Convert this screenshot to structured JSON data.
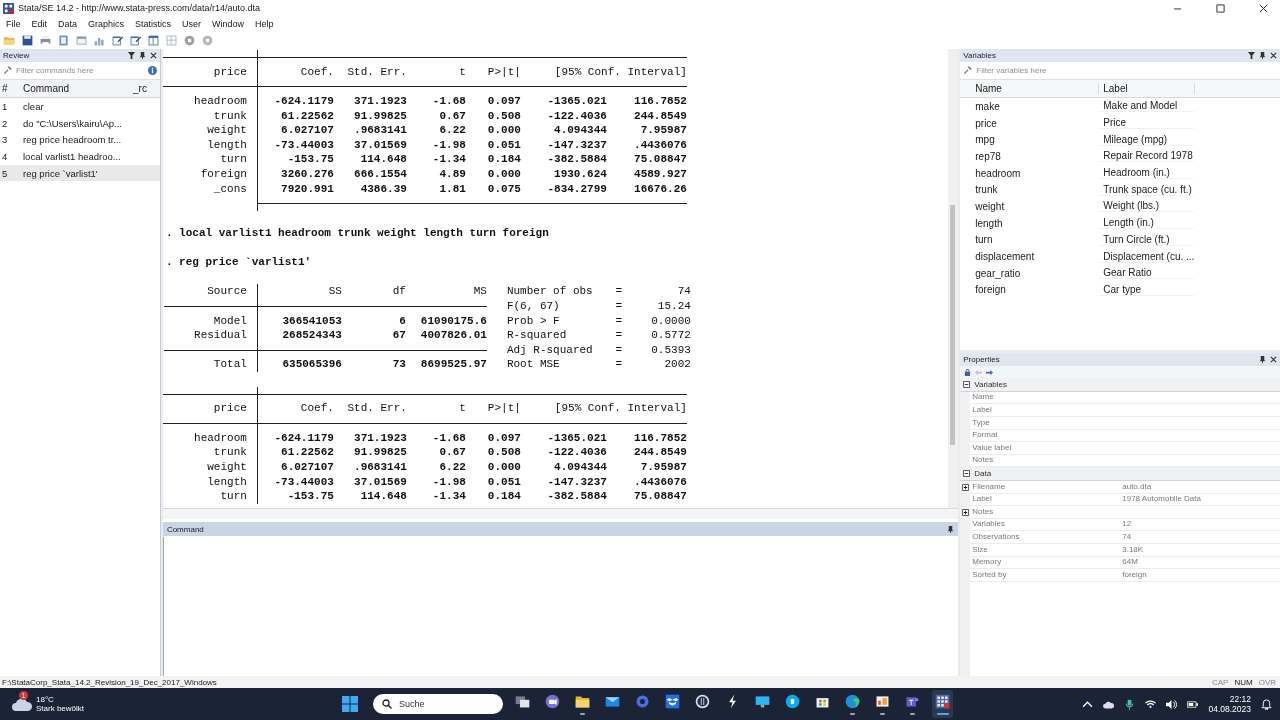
{
  "window": {
    "title": "Stata/SE 14.2 - http://www.stata-press.com/data/r14/auto.dta"
  },
  "menu": [
    "File",
    "Edit",
    "Data",
    "Graphics",
    "Statistics",
    "User",
    "Window",
    "Help"
  ],
  "review": {
    "title": "Review",
    "placeholder": "Filter commands here",
    "columns": [
      "#",
      "Command",
      "_rc"
    ],
    "rows": [
      {
        "n": "1",
        "command": "clear",
        "selected": false
      },
      {
        "n": "2",
        "command": "do \"C:\\Users\\kairu\\Ap...",
        "selected": false
      },
      {
        "n": "3",
        "command": "reg price headroom tr...",
        "selected": false
      },
      {
        "n": "4",
        "command": "local varlist1 headroo...",
        "selected": false
      },
      {
        "n": "5",
        "command": "reg price `varlist1'",
        "selected": true
      }
    ]
  },
  "results": [
    {
      "kind": "coef_table",
      "bottom_rule": true,
      "header": [
        "price",
        "Coef.",
        "Std. Err.",
        "t",
        "P>|t|",
        "[95% Conf. Interval]"
      ],
      "rows": [
        {
          "name": "headroom",
          "values": [
            "-624.1179",
            "371.1923",
            "-1.68",
            "0.097",
            "-1365.021",
            "116.7852"
          ]
        },
        {
          "name": "trunk",
          "values": [
            "61.22562",
            "91.99825",
            "0.67",
            "0.508",
            "-122.4036",
            "244.8549"
          ]
        },
        {
          "name": "weight",
          "values": [
            "6.027107",
            ".9683141",
            "6.22",
            "0.000",
            "4.094344",
            "7.95987"
          ]
        },
        {
          "name": "length",
          "values": [
            "-73.44003",
            "37.01569",
            "-1.98",
            "0.051",
            "-147.3237",
            ".4436076"
          ]
        },
        {
          "name": "turn",
          "values": [
            "-153.75",
            "114.648",
            "-1.34",
            "0.184",
            "-382.5884",
            "75.08847"
          ]
        },
        {
          "name": "foreign",
          "values": [
            "3260.276",
            "666.1554",
            "4.89",
            "0.000",
            "1930.624",
            "4589.927"
          ]
        },
        {
          "name": "_cons",
          "values": [
            "7920.991",
            "4386.39",
            "1.81",
            "0.075",
            "-834.2799",
            "16676.26"
          ]
        }
      ]
    },
    {
      "kind": "blank"
    },
    {
      "kind": "command",
      "text": ". local varlist1 headroom trunk weight length turn foreign"
    },
    {
      "kind": "blank"
    },
    {
      "kind": "command",
      "text": ". reg price `varlist1'"
    },
    {
      "kind": "blank"
    },
    {
      "kind": "anova",
      "header": [
        "Source",
        "SS",
        "df",
        "MS"
      ],
      "rows": [
        {
          "source": "Model",
          "values": [
            "366541053",
            "6",
            "61090175.6"
          ]
        },
        {
          "source": "Residual",
          "values": [
            "268524343",
            "67",
            "4007826.01"
          ]
        }
      ],
      "total": {
        "source": "Total",
        "values": [
          "635065396",
          "73",
          "8699525.97"
        ]
      },
      "stats": [
        {
          "label": "Number of obs",
          "eq": "=",
          "value": "74"
        },
        {
          "label": "F(6, 67)",
          "eq": "=",
          "value": "15.24"
        },
        {
          "label": "Prob > F",
          "eq": "=",
          "value": "0.0000"
        },
        {
          "label": "R-squared",
          "eq": "=",
          "value": "0.5772"
        },
        {
          "label": "Adj R-squared",
          "eq": "=",
          "value": "0.5393"
        },
        {
          "label": "Root MSE",
          "eq": "=",
          "value": "2002"
        }
      ]
    },
    {
      "kind": "blank"
    },
    {
      "kind": "coef_table",
      "bottom_rule": false,
      "header": [
        "price",
        "Coef.",
        "Std. Err.",
        "t",
        "P>|t|",
        "[95% Conf. Interval]"
      ],
      "rows": [
        {
          "name": "headroom",
          "values": [
            "-624.1179",
            "371.1923",
            "-1.68",
            "0.097",
            "-1365.021",
            "116.7852"
          ]
        },
        {
          "name": "trunk",
          "values": [
            "61.22562",
            "91.99825",
            "0.67",
            "0.508",
            "-122.4036",
            "244.8549"
          ]
        },
        {
          "name": "weight",
          "values": [
            "6.027107",
            ".9683141",
            "6.22",
            "0.000",
            "4.094344",
            "7.95987"
          ]
        },
        {
          "name": "length",
          "values": [
            "-73.44003",
            "37.01569",
            "-1.98",
            "0.051",
            "-147.3237",
            ".4436076"
          ]
        },
        {
          "name": "turn",
          "values": [
            "-153.75",
            "114.648",
            "-1.34",
            "0.184",
            "-382.5884",
            "75.08847"
          ]
        }
      ]
    }
  ],
  "command_window": {
    "title": "Command"
  },
  "variables": {
    "title": "Variables",
    "placeholder": "Filter variables here",
    "columns": [
      "Name",
      "Label"
    ],
    "rows": [
      {
        "name": "make",
        "label": "Make and Model"
      },
      {
        "name": "price",
        "label": "Price"
      },
      {
        "name": "mpg",
        "label": "Mileage (mpg)"
      },
      {
        "name": "rep78",
        "label": "Repair Record 1978"
      },
      {
        "name": "headroom",
        "label": "Headroom (in.)"
      },
      {
        "name": "trunk",
        "label": "Trunk space (cu. ft.)"
      },
      {
        "name": "weight",
        "label": "Weight (lbs.)"
      },
      {
        "name": "length",
        "label": "Length (in.)"
      },
      {
        "name": "turn",
        "label": "Turn Circle (ft.)"
      },
      {
        "name": "displacement",
        "label": "Displacement (cu. ..."
      },
      {
        "name": "gear_ratio",
        "label": "Gear Ratio"
      },
      {
        "name": "foreign",
        "label": "Car type"
      }
    ]
  },
  "properties": {
    "title": "Properties",
    "groups": [
      {
        "title": "Variables",
        "expanded": true,
        "items": [
          {
            "name": "Name",
            "expandable": false
          },
          {
            "name": "Label",
            "expandable": false
          },
          {
            "name": "Type",
            "expandable": false
          },
          {
            "name": "Format",
            "expandable": false
          },
          {
            "name": "Value label",
            "expandable": false
          },
          {
            "name": "Notes",
            "expandable": false
          }
        ]
      },
      {
        "title": "Data",
        "expanded": true,
        "items": [
          {
            "name": "Filename",
            "value": "auto.dta",
            "expandable": true
          },
          {
            "name": "Label",
            "value": "1978 Automobile Data",
            "expandable": false
          },
          {
            "name": "Notes",
            "expandable": true
          },
          {
            "name": "Variables",
            "value": "12",
            "expandable": false
          },
          {
            "name": "Observations",
            "value": "74",
            "expandable": false
          },
          {
            "name": "Size",
            "value": "3.18K",
            "expandable": false
          },
          {
            "name": "Memory",
            "value": "64M",
            "expandable": false
          },
          {
            "name": "Sorted by",
            "value": "foreign",
            "expandable": false
          }
        ]
      }
    ]
  },
  "status": {
    "path": "F:\\StataCorp_Stata_14.2_Revision_19_Dec_2017_Windows",
    "indicators": [
      {
        "label": "CAP",
        "on": false
      },
      {
        "label": "NUM",
        "on": true
      },
      {
        "label": "OVR",
        "on": false
      }
    ]
  },
  "taskbar": {
    "weather": {
      "badge": "1",
      "temp": "18°C",
      "text": "Stark bewölkt"
    },
    "search": {
      "placeholder": "Suche"
    },
    "apps": [
      {
        "running": false,
        "selected": false
      },
      {
        "running": false,
        "selected": false
      },
      {
        "running": true,
        "selected": false
      },
      {
        "running": false,
        "selected": false
      },
      {
        "running": false,
        "selected": false
      },
      {
        "running": false,
        "selected": false
      },
      {
        "running": false,
        "selected": false
      },
      {
        "running": false,
        "selected": false
      },
      {
        "running": false,
        "selected": false
      },
      {
        "running": false,
        "selected": false
      },
      {
        "running": false,
        "selected": false
      },
      {
        "running": true,
        "selected": false
      },
      {
        "running": true,
        "selected": false
      },
      {
        "running": true,
        "selected": false
      },
      {
        "running": true,
        "selected": true
      }
    ],
    "clock": {
      "time": "22:12",
      "date": "04.08.2023"
    }
  }
}
